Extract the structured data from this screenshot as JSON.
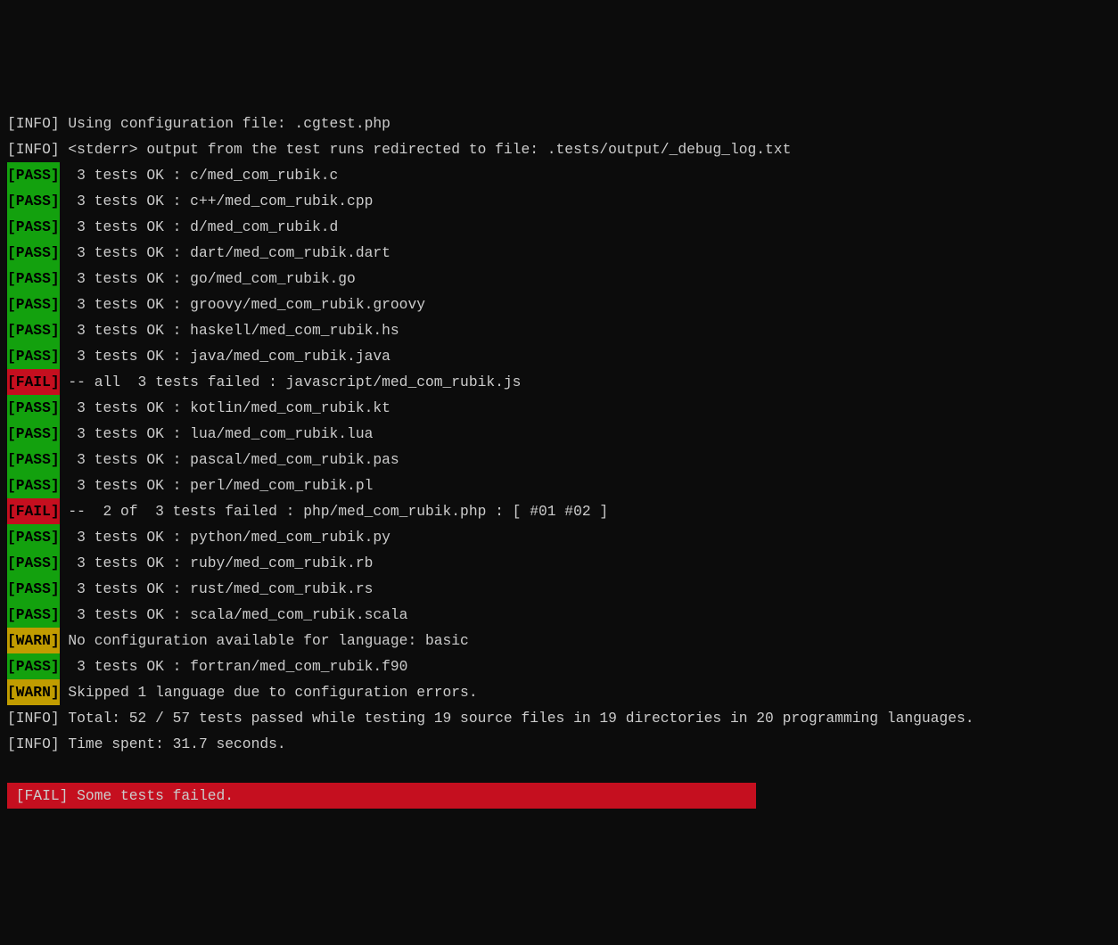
{
  "lines": [
    {
      "type": "info",
      "tag": "[INFO]",
      "text": " Using configuration file: .cgtest.php"
    },
    {
      "type": "info",
      "tag": "[INFO]",
      "text": " <stderr> output from the test runs redirected to file: .tests/output/_debug_log.txt"
    },
    {
      "type": "pass",
      "tag": "[PASS]",
      "text": "  3 tests OK : c/med_com_rubik.c"
    },
    {
      "type": "pass",
      "tag": "[PASS]",
      "text": "  3 tests OK : c++/med_com_rubik.cpp"
    },
    {
      "type": "pass",
      "tag": "[PASS]",
      "text": "  3 tests OK : d/med_com_rubik.d"
    },
    {
      "type": "pass",
      "tag": "[PASS]",
      "text": "  3 tests OK : dart/med_com_rubik.dart"
    },
    {
      "type": "pass",
      "tag": "[PASS]",
      "text": "  3 tests OK : go/med_com_rubik.go"
    },
    {
      "type": "pass",
      "tag": "[PASS]",
      "text": "  3 tests OK : groovy/med_com_rubik.groovy"
    },
    {
      "type": "pass",
      "tag": "[PASS]",
      "text": "  3 tests OK : haskell/med_com_rubik.hs"
    },
    {
      "type": "pass",
      "tag": "[PASS]",
      "text": "  3 tests OK : java/med_com_rubik.java"
    },
    {
      "type": "fail",
      "tag": "[FAIL]",
      "text": " -- all  3 tests failed : javascript/med_com_rubik.js"
    },
    {
      "type": "pass",
      "tag": "[PASS]",
      "text": "  3 tests OK : kotlin/med_com_rubik.kt"
    },
    {
      "type": "pass",
      "tag": "[PASS]",
      "text": "  3 tests OK : lua/med_com_rubik.lua"
    },
    {
      "type": "pass",
      "tag": "[PASS]",
      "text": "  3 tests OK : pascal/med_com_rubik.pas"
    },
    {
      "type": "pass",
      "tag": "[PASS]",
      "text": "  3 tests OK : perl/med_com_rubik.pl"
    },
    {
      "type": "fail",
      "tag": "[FAIL]",
      "text": " --  2 of  3 tests failed : php/med_com_rubik.php : [ #01 #02 ]"
    },
    {
      "type": "pass",
      "tag": "[PASS]",
      "text": "  3 tests OK : python/med_com_rubik.py"
    },
    {
      "type": "pass",
      "tag": "[PASS]",
      "text": "  3 tests OK : ruby/med_com_rubik.rb"
    },
    {
      "type": "pass",
      "tag": "[PASS]",
      "text": "  3 tests OK : rust/med_com_rubik.rs"
    },
    {
      "type": "pass",
      "tag": "[PASS]",
      "text": "  3 tests OK : scala/med_com_rubik.scala"
    },
    {
      "type": "warn",
      "tag": "[WARN]",
      "text": " No configuration available for language: basic"
    },
    {
      "type": "pass",
      "tag": "[PASS]",
      "text": "  3 tests OK : fortran/med_com_rubik.f90"
    },
    {
      "type": "warn",
      "tag": "[WARN]",
      "text": " Skipped 1 language due to configuration errors."
    },
    {
      "type": "info",
      "tag": "[INFO]",
      "text": " Total: 52 / 57 tests passed while testing 19 source files in 19 directories in 20 programming languages."
    },
    {
      "type": "info",
      "tag": "[INFO]",
      "text": " Time spent: 31.7 seconds."
    }
  ],
  "final": {
    "text": " [FAIL] Some tests failed.                                                            "
  }
}
